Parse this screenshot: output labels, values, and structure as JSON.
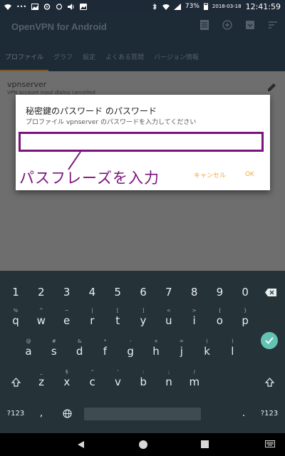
{
  "status": {
    "battery": "73%",
    "date": "2018-03-18",
    "time": "12:41:59"
  },
  "app": {
    "title": "OpenVPN for Android",
    "action_icons": [
      "list-icon",
      "add-icon",
      "import-icon",
      "sort-icon"
    ],
    "tabs": [
      {
        "label": "プロファイル",
        "active": true
      },
      {
        "label": "グラフ"
      },
      {
        "label": "設定"
      },
      {
        "label": "よくある質問"
      },
      {
        "label": "バージョン情報"
      }
    ]
  },
  "profile": {
    "name": "vpnserver",
    "status": "VPN account input dialog cancelled"
  },
  "dialog": {
    "title": "秘密鍵のパスワード のパスワード",
    "message": "プロファイル vpnserver のパスワードを入力してください",
    "input_value": "",
    "cancel_label": "キャンセル",
    "ok_label": "OK"
  },
  "annotation": {
    "text": "パスフレーズを入力",
    "color": "#7b127e"
  },
  "keyboard": {
    "row1": [
      "1",
      "2",
      "3",
      "4",
      "5",
      "6",
      "7",
      "8",
      "9",
      "0"
    ],
    "row2": [
      {
        "k": "q",
        "h": "%"
      },
      {
        "k": "w",
        "h": "^"
      },
      {
        "k": "e",
        "h": "~"
      },
      {
        "k": "r",
        "h": "|"
      },
      {
        "k": "t",
        "h": "["
      },
      {
        "k": "y",
        "h": "]"
      },
      {
        "k": "u",
        "h": "<"
      },
      {
        "k": "i",
        "h": ">"
      },
      {
        "k": "o",
        "h": "{"
      },
      {
        "k": "p",
        "h": "}"
      }
    ],
    "row3": [
      {
        "k": "a",
        "h": "@"
      },
      {
        "k": "s",
        "h": "#"
      },
      {
        "k": "d",
        "h": "&"
      },
      {
        "k": "f",
        "h": "*"
      },
      {
        "k": "g",
        "h": "-"
      },
      {
        "k": "h",
        "h": "+"
      },
      {
        "k": "j",
        "h": "="
      },
      {
        "k": "k",
        "h": "("
      },
      {
        "k": "l",
        "h": ")"
      }
    ],
    "row4": [
      {
        "k": "z",
        "h": "_"
      },
      {
        "k": "x",
        "h": "$"
      },
      {
        "k": "c",
        "h": "\""
      },
      {
        "k": "v",
        "h": "'"
      },
      {
        "k": "b",
        "h": ":"
      },
      {
        "k": "n",
        "h": ";"
      },
      {
        "k": "m",
        "h": "/"
      }
    ],
    "symbols_label": "?123",
    "comma": ",",
    "period": ".",
    "accent_color": "#64c2b4"
  }
}
